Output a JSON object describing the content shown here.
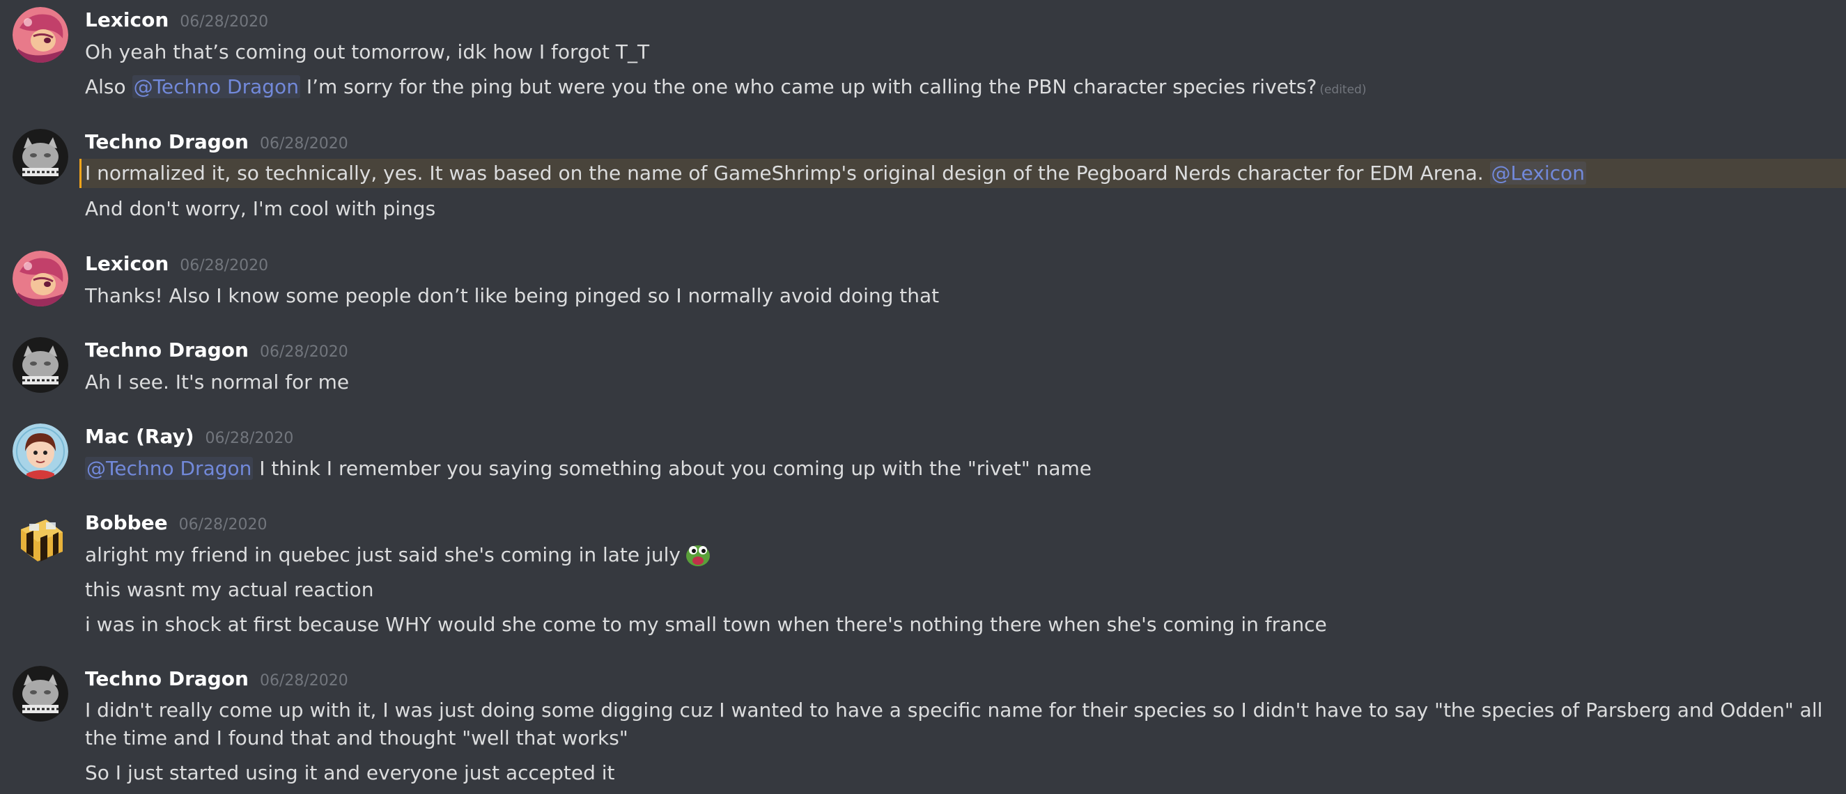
{
  "colors": {
    "background": "#36393f",
    "username": "#ffffff",
    "timestamp": "#72767d",
    "text": "#dcddde",
    "mention": "#7289da",
    "highlight": "#faa61a"
  },
  "messages": [
    {
      "author": "Lexicon",
      "timestamp": "06/28/2020",
      "avatar": "lexicon-avatar",
      "lines": [
        "Oh yeah that’s coming out tomorrow, idk how I forgot T_T",
        {
          "pre": "Also ",
          "mention": "@Techno Dragon",
          "post": " I’m sorry for the ping but were you the one who came up with calling the PBN character species rivets?",
          "edited": "(edited)"
        }
      ]
    },
    {
      "author": "Techno Dragon",
      "timestamp": "06/28/2020",
      "avatar": "techno-dragon-avatar",
      "lines": [
        {
          "pre": "I normalized it, so technically, yes. It was based on the name of GameShrimp's original design of the Pegboard Nerds character for EDM Arena. ",
          "mention": "@Lexicon",
          "highlighted": true
        },
        "And don't worry, I'm cool with pings"
      ]
    },
    {
      "author": "Lexicon",
      "timestamp": "06/28/2020",
      "avatar": "lexicon-avatar",
      "lines": [
        "Thanks! Also I know some people don’t like being pinged so I normally avoid doing that"
      ]
    },
    {
      "author": "Techno Dragon",
      "timestamp": "06/28/2020",
      "avatar": "techno-dragon-avatar",
      "lines": [
        "Ah I see. It's normal for me"
      ]
    },
    {
      "author": "Mac (Ray)",
      "timestamp": "06/28/2020",
      "avatar": "mac-avatar",
      "lines": [
        {
          "mention": "@Techno Dragon",
          "post": " I think I remember you saying something about you coming up with the \"rivet\" name"
        }
      ]
    },
    {
      "author": "Bobbee",
      "timestamp": "06/28/2020",
      "avatar": "bee-avatar",
      "lines": [
        {
          "pre": "alright my friend in quebec just said she's coming in late july",
          "emoji": "pepe-emoji"
        },
        "this wasnt my actual reaction",
        "i was in shock at first because WHY would she come to my small town when there's nothing there when she's coming in france"
      ]
    },
    {
      "author": "Techno Dragon",
      "timestamp": "06/28/2020",
      "avatar": "techno-dragon-avatar",
      "lines": [
        "I didn't really come up with it, I was just doing some digging cuz I wanted to have a specific name for their species so I didn't have to say \"the species of Parsberg and Odden\" all the time and I found that and thought \"well that works\"",
        "So I just started using it and everyone just accepted it"
      ]
    }
  ]
}
